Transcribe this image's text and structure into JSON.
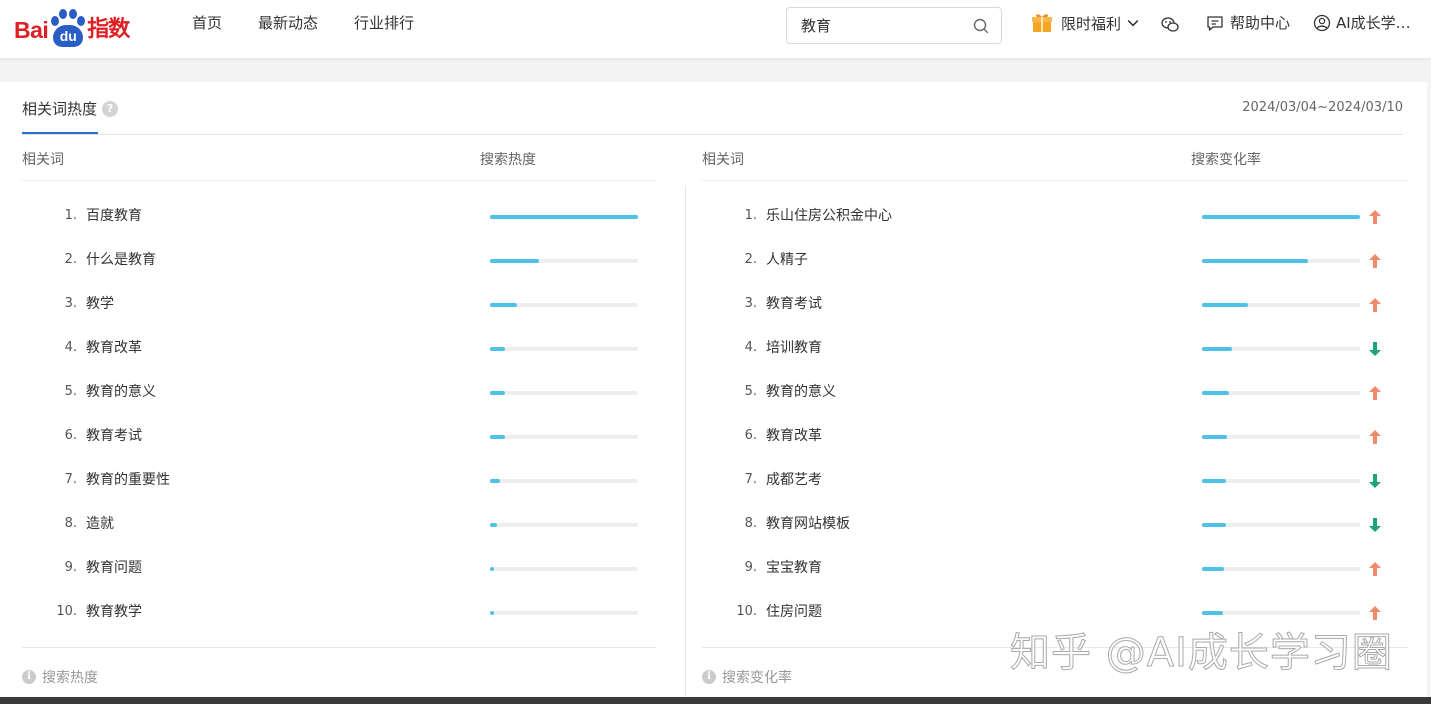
{
  "logo": {
    "text_bai": "Bai",
    "text_du": "du",
    "text_zhishu": "指数"
  },
  "nav": {
    "items": [
      "首页",
      "最新动态",
      "行业排行"
    ]
  },
  "search": {
    "value": "教育"
  },
  "header_right": {
    "gift_label": "限时福利",
    "help_label": "帮助中心",
    "user_label": "AI成长学…"
  },
  "section": {
    "tab_label": "相关词热度",
    "date_range": "2024/03/04~2024/03/10"
  },
  "left_table": {
    "col_word": "相关词",
    "col_metric": "搜索热度",
    "rows": [
      {
        "rank": "1.",
        "word": "百度教育",
        "value": 1.0
      },
      {
        "rank": "2.",
        "word": "什么是教育",
        "value": 0.33
      },
      {
        "rank": "3.",
        "word": "教学",
        "value": 0.18
      },
      {
        "rank": "4.",
        "word": "教育改革",
        "value": 0.1
      },
      {
        "rank": "5.",
        "word": "教育的意义",
        "value": 0.1
      },
      {
        "rank": "6.",
        "word": "教育考试",
        "value": 0.1
      },
      {
        "rank": "7.",
        "word": "教育的重要性",
        "value": 0.07
      },
      {
        "rank": "8.",
        "word": "造就",
        "value": 0.05
      },
      {
        "rank": "9.",
        "word": "教育问题",
        "value": 0.03
      },
      {
        "rank": "10.",
        "word": "教育教学",
        "value": 0.03
      }
    ],
    "footer_title": "搜索热度"
  },
  "right_table": {
    "col_word": "相关词",
    "col_metric": "搜索变化率",
    "rows": [
      {
        "rank": "1.",
        "word": "乐山住房公积金中心",
        "value": 1.0,
        "trend": "up"
      },
      {
        "rank": "2.",
        "word": "人精子",
        "value": 0.67,
        "trend": "up"
      },
      {
        "rank": "3.",
        "word": "教育考试",
        "value": 0.29,
        "trend": "up"
      },
      {
        "rank": "4.",
        "word": "培训教育",
        "value": 0.19,
        "trend": "down"
      },
      {
        "rank": "5.",
        "word": "教育的意义",
        "value": 0.17,
        "trend": "up"
      },
      {
        "rank": "6.",
        "word": "教育改革",
        "value": 0.16,
        "trend": "up"
      },
      {
        "rank": "7.",
        "word": "成都艺考",
        "value": 0.15,
        "trend": "down"
      },
      {
        "rank": "8.",
        "word": "教育网站模板",
        "value": 0.15,
        "trend": "down"
      },
      {
        "rank": "9.",
        "word": "宝宝教育",
        "value": 0.14,
        "trend": "up"
      },
      {
        "rank": "10.",
        "word": "住房问题",
        "value": 0.13,
        "trend": "up"
      }
    ],
    "footer_title": "搜索变化率"
  },
  "watermark": "知乎 @AI成长学习圈",
  "colors": {
    "bar": "#4fc1e9",
    "track": "#eeeeee",
    "up": "#f08a6c",
    "down": "#1fa37a",
    "tab_accent": "#2a6ecf"
  }
}
